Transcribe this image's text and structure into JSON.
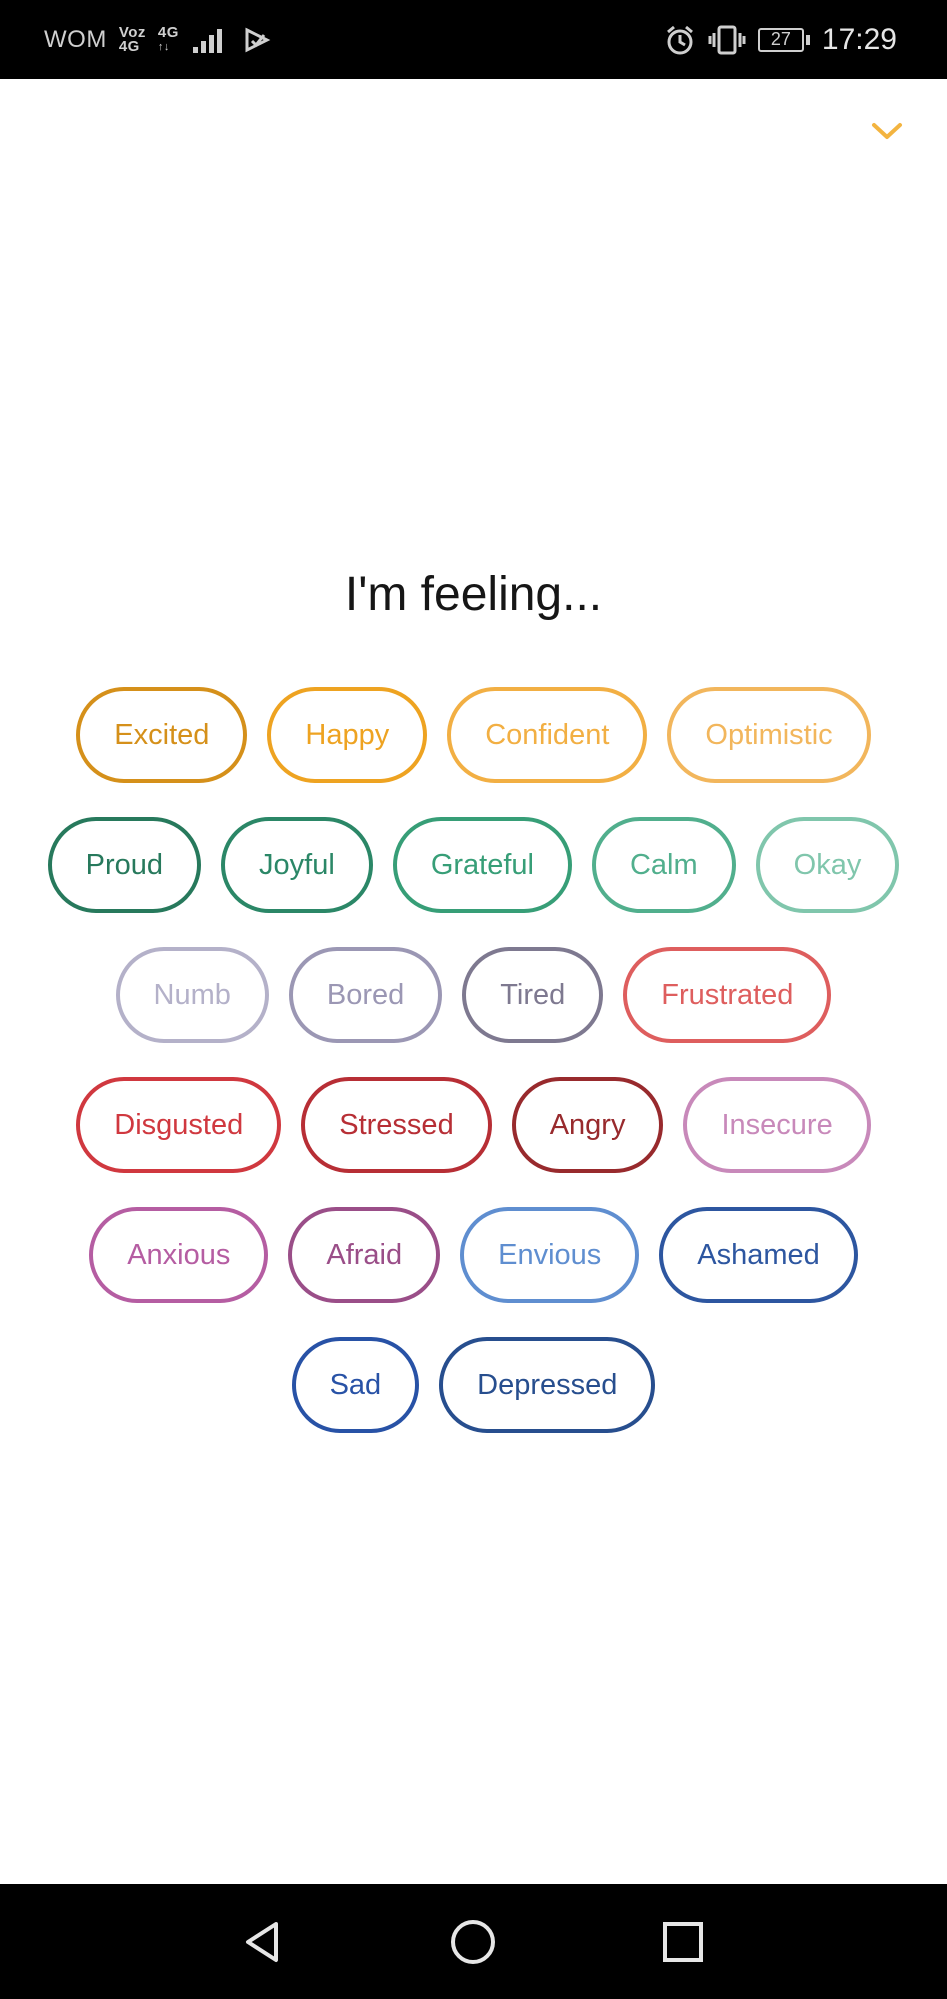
{
  "status_bar": {
    "carrier": "WOM",
    "voz": "Voz",
    "voz_net": "4G",
    "network": "4G",
    "battery": "27",
    "time": "17:29"
  },
  "colors": {
    "accent_orange": "#F3B440"
  },
  "title": "I'm feeling...",
  "emotion_rows": [
    [
      {
        "label": "Excited",
        "color": "#D5901A"
      },
      {
        "label": "Happy",
        "color": "#EEA321"
      },
      {
        "label": "Confident",
        "color": "#F2AF43"
      },
      {
        "label": "Optimistic",
        "color": "#F2B65C"
      }
    ],
    [
      {
        "label": "Proud",
        "color": "#27795C"
      },
      {
        "label": "Joyful",
        "color": "#2B8767"
      },
      {
        "label": "Grateful",
        "color": "#379E77"
      },
      {
        "label": "Calm",
        "color": "#51AF8D"
      },
      {
        "label": "Okay",
        "color": "#80C6AC"
      }
    ],
    [
      {
        "label": "Numb",
        "color": "#B4B1C9"
      },
      {
        "label": "Bored",
        "color": "#9B97B4"
      },
      {
        "label": "Tired",
        "color": "#7E7990"
      },
      {
        "label": "Frustrated",
        "color": "#DE5E5E"
      }
    ],
    [
      {
        "label": "Disgusted",
        "color": "#D0383F"
      },
      {
        "label": "Stressed",
        "color": "#B72E35"
      },
      {
        "label": "Angry",
        "color": "#982A2D"
      },
      {
        "label": "Insecure",
        "color": "#C889BA"
      }
    ],
    [
      {
        "label": "Anxious",
        "color": "#B55DA2"
      },
      {
        "label": "Afraid",
        "color": "#9A4E88"
      },
      {
        "label": "Envious",
        "color": "#5F8ED0"
      },
      {
        "label": "Ashamed",
        "color": "#2D56A0"
      }
    ],
    [
      {
        "label": "Sad",
        "color": "#2852A6"
      },
      {
        "label": "Depressed",
        "color": "#274E8E"
      }
    ]
  ]
}
